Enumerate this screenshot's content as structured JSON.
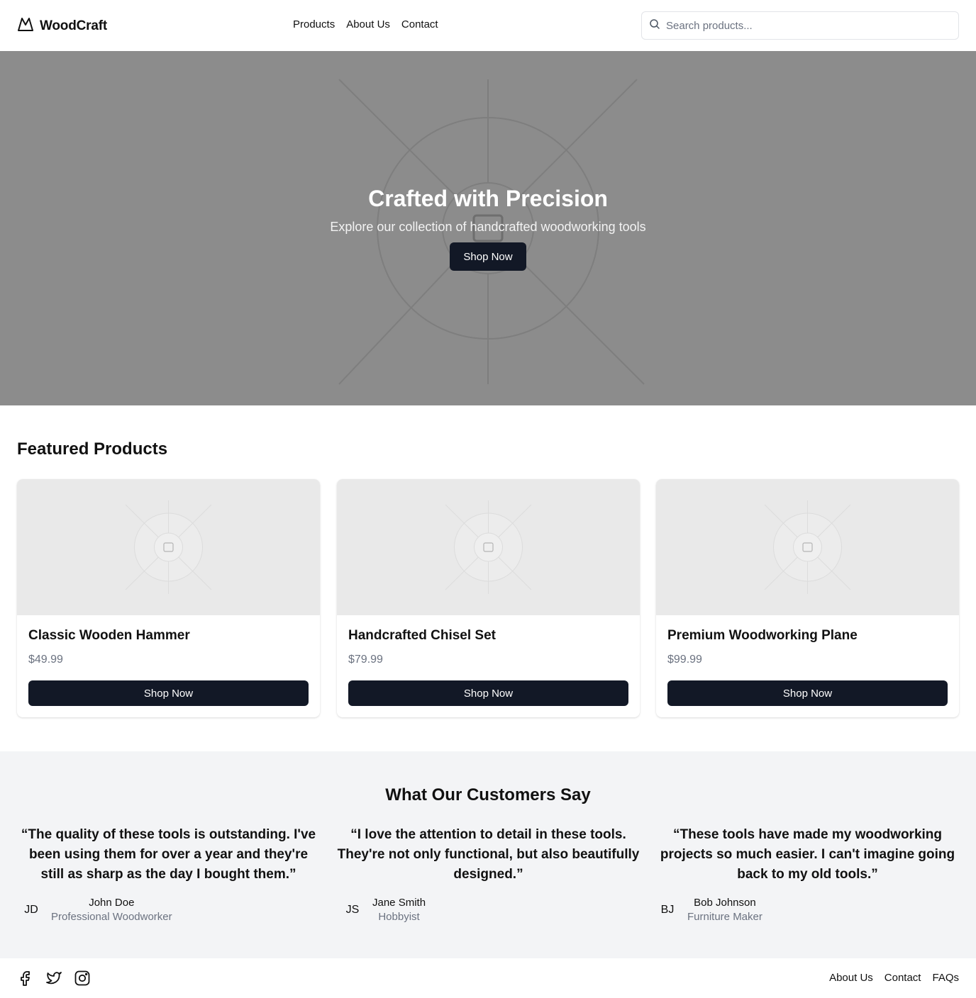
{
  "header": {
    "brand": "WoodCraft",
    "logo_icon": "mountain-icon",
    "nav": [
      {
        "label": "Products"
      },
      {
        "label": "About Us"
      },
      {
        "label": "Contact"
      }
    ],
    "search": {
      "placeholder": "Search products...",
      "value": "",
      "icon": "search-icon"
    }
  },
  "hero": {
    "title": "Crafted with Precision",
    "subtitle": "Explore our collection of handcrafted woodworking tools",
    "cta": "Shop Now",
    "background_color": "#8c8c8c"
  },
  "featured": {
    "title": "Featured Products",
    "products": [
      {
        "name": "Classic Wooden Hammer",
        "price": "$49.99",
        "cta": "Shop Now"
      },
      {
        "name": "Handcrafted Chisel Set",
        "price": "$79.99",
        "cta": "Shop Now"
      },
      {
        "name": "Premium Woodworking Plane",
        "price": "$99.99",
        "cta": "Shop Now"
      }
    ]
  },
  "testimonials": {
    "title": "What Our Customers Say",
    "items": [
      {
        "quote": "“The quality of these tools is outstanding. I've been using them for over a year and they're still as sharp as the day I bought them.”",
        "initials": "JD",
        "name": "John Doe",
        "role": "Professional Woodworker"
      },
      {
        "quote": "“I love the attention to detail in these tools. They're not only functional, but also beautifully designed.”",
        "initials": "JS",
        "name": "Jane Smith",
        "role": "Hobbyist"
      },
      {
        "quote": "“These tools have made my woodworking projects so much easier. I can't imagine going back to my old tools.”",
        "initials": "BJ",
        "name": "Bob Johnson",
        "role": "Furniture Maker"
      }
    ]
  },
  "footer": {
    "socials": [
      "facebook-icon",
      "twitter-icon",
      "instagram-icon"
    ],
    "links": [
      {
        "label": "About Us"
      },
      {
        "label": "Contact"
      },
      {
        "label": "FAQs"
      }
    ]
  },
  "colors": {
    "primary_button": "#121826",
    "muted_text": "#6b7280",
    "testimonial_bg": "#f3f4f6",
    "image_placeholder": "#e9e9e9"
  }
}
